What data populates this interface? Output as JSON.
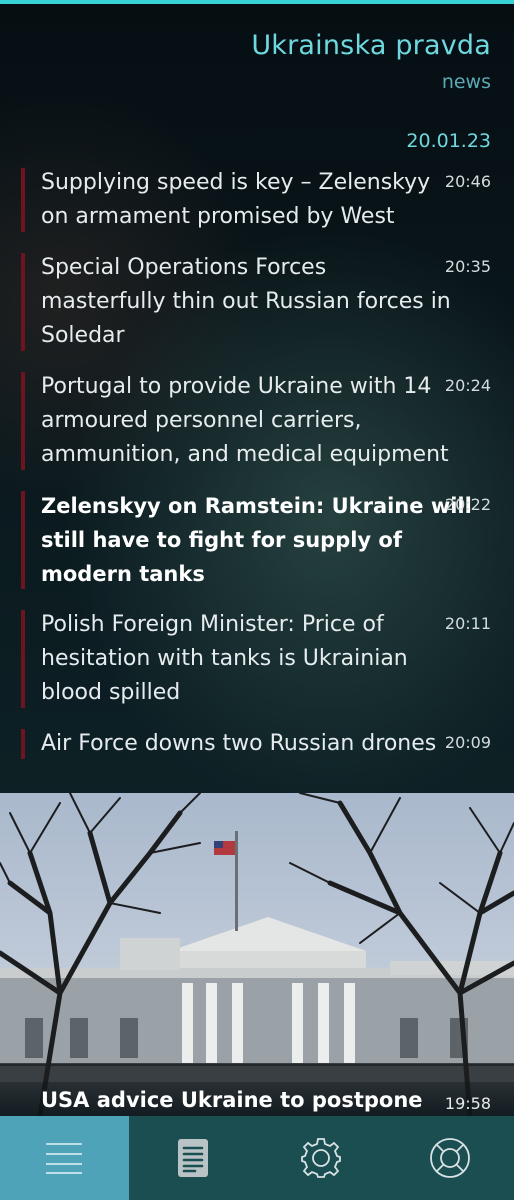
{
  "header": {
    "title": "Ukrainska pravda",
    "subtitle": "news"
  },
  "date": "20.01.23",
  "news": [
    {
      "headline_lines": [
        "Supplying speed is key – Zelenskyy",
        "on armament promised by West"
      ],
      "time": "20:46",
      "bold": false
    },
    {
      "headline_lines": [
        "Special Operations Forces",
        "masterfully thin out Russian forces in",
        "Soledar"
      ],
      "time": "20:35",
      "bold": false
    },
    {
      "headline_lines": [
        "Portugal to provide Ukraine with 14",
        "armoured personnel carriers,",
        "ammunition, and medical equipment"
      ],
      "time": "20:24",
      "bold": false
    },
    {
      "headline_lines": [
        "Zelenskyy on Ramstein: Ukraine will",
        "still have to fight for supply of",
        "modern tanks"
      ],
      "time": "20:22",
      "bold": true
    },
    {
      "headline_lines": [
        "Polish Foreign Minister: Price of",
        "hesitation with tanks is Ukrainian",
        "blood spilled"
      ],
      "time": "20:11",
      "bold": false
    },
    {
      "headline_lines": [
        "Air Force downs two Russian drones"
      ],
      "time": "20:09",
      "bold": false
    }
  ],
  "featured": {
    "headline": "USA advice Ukraine to postpone",
    "time": "19:58"
  },
  "tabs": [
    {
      "icon": "menu-icon",
      "active": true
    },
    {
      "icon": "document-icon",
      "active": false
    },
    {
      "icon": "gear-icon",
      "active": false
    },
    {
      "icon": "lifebuoy-icon",
      "active": false
    }
  ],
  "colors": {
    "accent": "#38d3d6",
    "title": "#6fd8df",
    "item_bar": "#6e1320",
    "tabbar": "#1b4e51",
    "tab_active": "#4fa3b9"
  }
}
